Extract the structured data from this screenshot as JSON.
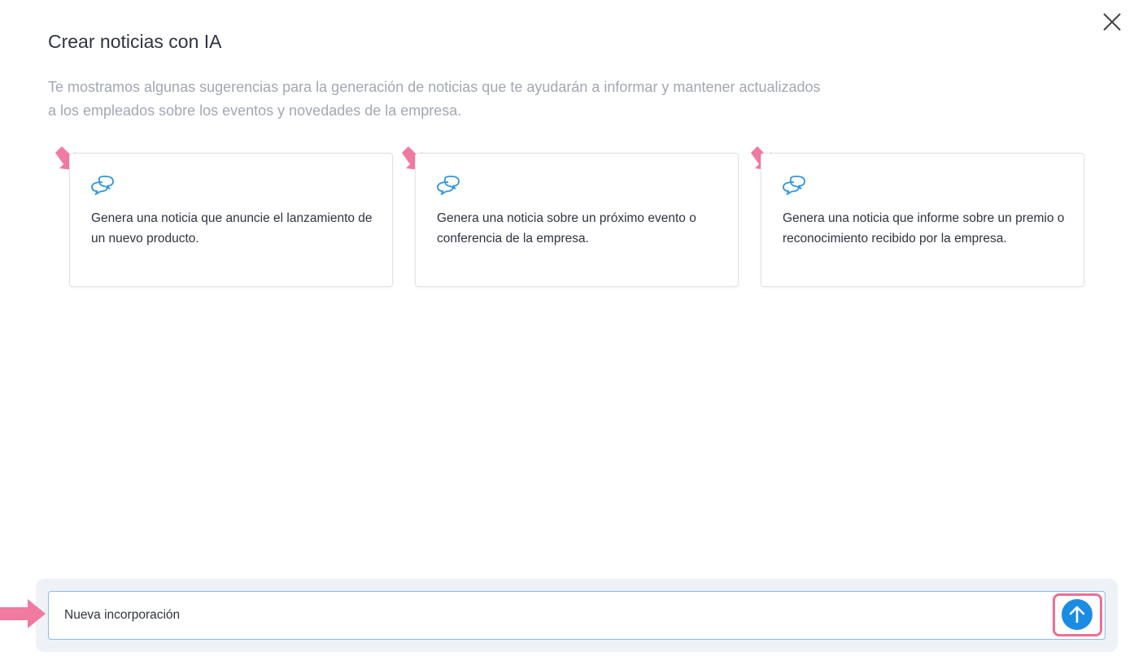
{
  "dialog": {
    "title": "Crear noticias con IA",
    "subtitle": "Te mostramos algunas sugerencias para la generación de noticias que te ayudarán a informar y mantener actualizados a los empleados sobre los eventos y novedades de la empresa."
  },
  "suggestions": [
    {
      "icon": "chat-bubbles-icon",
      "text": "Genera una noticia que anuncie el lanzamiento de un nuevo producto."
    },
    {
      "icon": "chat-bubbles-icon",
      "text": "Genera una noticia sobre un próximo evento o conferencia de la empresa."
    },
    {
      "icon": "chat-bubbles-icon",
      "text": "Genera una noticia que informe sobre un premio o reconocimiento recibido por la empresa."
    }
  ],
  "prompt": {
    "value": "Nueva incorporación",
    "send_icon": "arrow-up-icon"
  },
  "colors": {
    "accent": "#1a8ce3",
    "highlight": "#ec6f92",
    "card_icon": "#2f95dd",
    "annotation_arrow": "#f07aa0"
  }
}
